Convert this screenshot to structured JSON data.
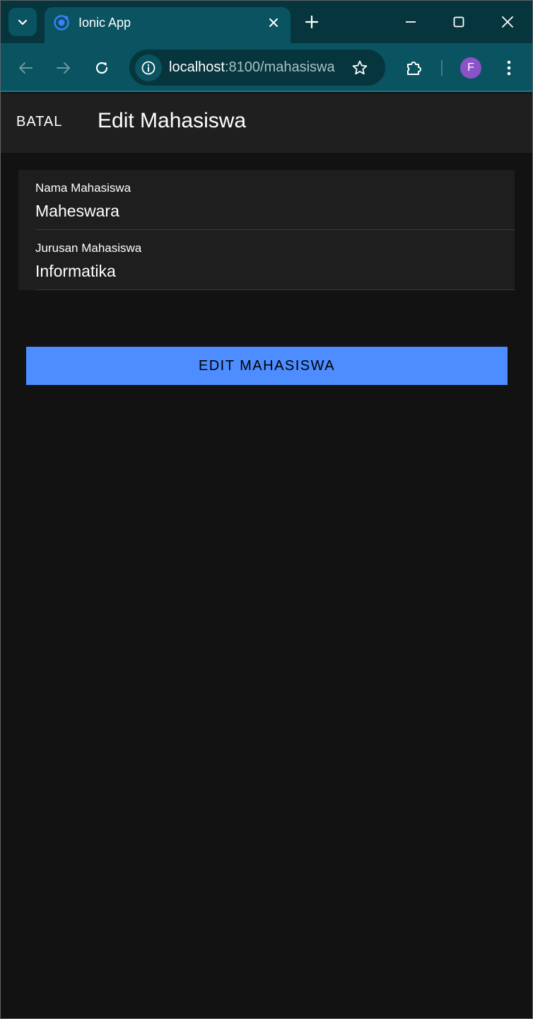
{
  "browser": {
    "tab_title": "Ionic App",
    "url_host": "localhost",
    "url_rest": ":8100/mahasiswa",
    "profile_initial": "F",
    "colors": {
      "frame": "#06353d",
      "toolbar": "#0a5360",
      "favicon": "#3880ff",
      "avatar": "#8a53c9"
    },
    "icons": {
      "tab_search": "chevron-down-icon",
      "favicon": "ionic-logo-icon",
      "close_tab": "close-icon",
      "new_tab": "plus-icon",
      "minimize": "minimize-icon",
      "maximize": "maximize-icon",
      "close_window": "close-icon",
      "back": "arrow-left-icon",
      "forward": "arrow-right-icon",
      "reload": "reload-icon",
      "site_info": "info-icon",
      "bookmark": "star-icon",
      "extensions": "puzzle-icon",
      "menu": "kebab-menu-icon"
    }
  },
  "app": {
    "header": {
      "cancel_label": "BATAL",
      "title": "Edit Mahasiswa"
    },
    "form": {
      "nama": {
        "label": "Nama Mahasiswa",
        "value": "Maheswara"
      },
      "jurusan": {
        "label": "Jurusan Mahasiswa",
        "value": "Informatika"
      }
    },
    "submit_label": "EDIT MAHASISWA",
    "colors": {
      "background": "#121212",
      "header": "#1f1f1f",
      "item": "#1e1e1e",
      "primary": "#4e8dff"
    }
  }
}
